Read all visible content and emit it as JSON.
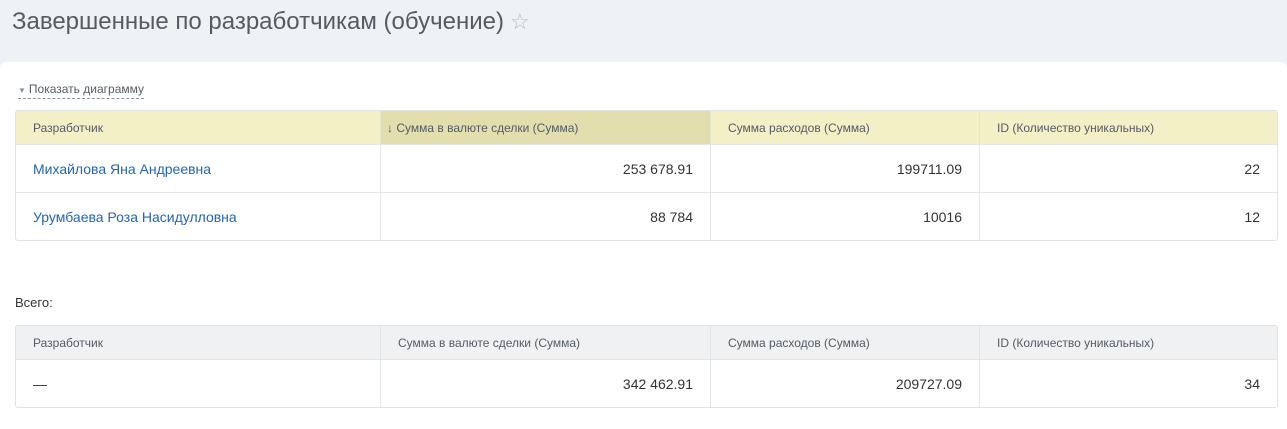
{
  "page": {
    "title": "Завершенные по разработчикам (обучение)",
    "star_icon": "☆"
  },
  "toggle": {
    "label": "Показать диаграмму",
    "arrow": "▼"
  },
  "columns": [
    "Разработчик",
    "Сумма в валюте сделки (Сумма)",
    "Сумма расходов (Сумма)",
    "ID (Количество уникальных)"
  ],
  "sort_arrow": "↓",
  "rows": [
    {
      "developer": "Михайлова Яна Андреевна",
      "deal_sum": "253 678.91",
      "expenses": "199711.09",
      "unique_ids": "22"
    },
    {
      "developer": "Урумбаева Роза Насидулловна",
      "deal_sum": "88 784",
      "expenses": "10016",
      "unique_ids": "12"
    }
  ],
  "total": {
    "label": "Всего:",
    "columns": [
      "Разработчик",
      "Сумма в валюте сделки (Сумма)",
      "Сумма расходов (Сумма)",
      "ID (Количество уникальных)"
    ],
    "row": {
      "developer": "—",
      "deal_sum": "342 462.91",
      "expenses": "209727.09",
      "unique_ids": "34"
    }
  },
  "colors": {
    "header_bg": "#f3efc6",
    "sorted_header_bg": "#e3deae",
    "link": "#2067b0"
  }
}
